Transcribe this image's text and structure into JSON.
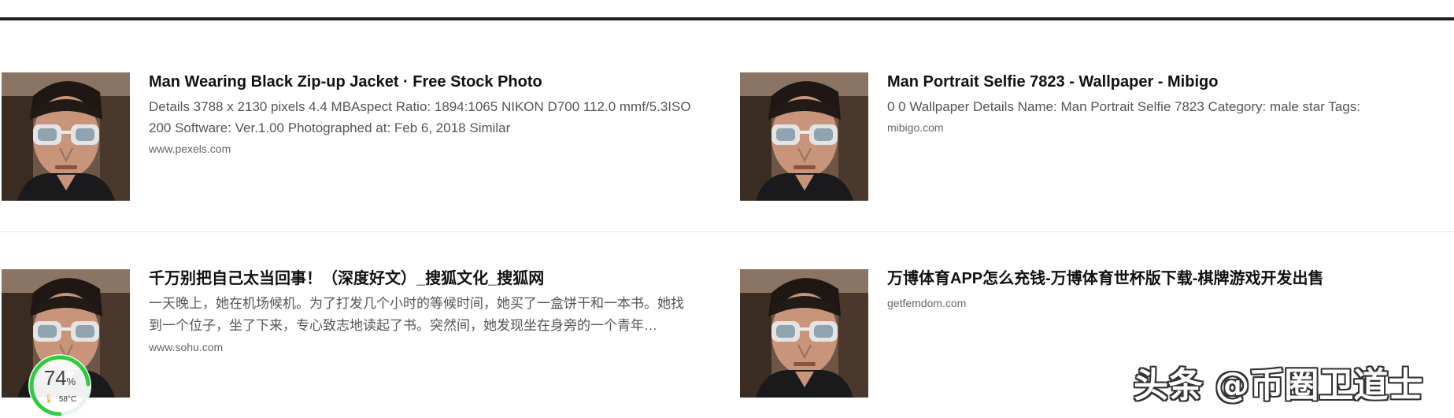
{
  "results": [
    {
      "title": "Man Wearing Black Zip-up Jacket · Free Stock Photo",
      "snippet": "Details 3788 x 2130 pixels 4.4 MBAspect Ratio: 1894:1065 NIKON D700 112.0 mmf/5.3ISO 200 Software: Ver.1.00 Photographed at: Feb 6, 2018 Similar",
      "url": "www.pexels.com",
      "thumbnail_icon": "man-sunglasses-photo"
    },
    {
      "title": "Man Portrait Selfie 7823 - Wallpaper - Mibigo",
      "snippet": "0 0 Wallpaper Details Name: Man Portrait Selfie 7823 Category: male star Tags:",
      "url": "mibigo.com",
      "thumbnail_icon": "man-sunglasses-photo"
    },
    {
      "title": "千万别把自己太当回事！（深度好文）_搜狐文化_搜狐网",
      "snippet": "一天晚上，她在机场候机。为了打发几个小时的等候时间，她买了一盒饼干和一本书。她找到一个位子，坐了下来，专心致志地读起了书。突然间，她发现坐在身旁的一个青年…",
      "url": "www.sohu.com",
      "thumbnail_icon": "man-sunglasses-photo"
    },
    {
      "title": "万博体育APP怎么充钱-万博体育世杯版下载-棋牌游戏开发出售",
      "snippet": "",
      "url": "getfemdom.com",
      "thumbnail_icon": "man-sunglasses-photo"
    }
  ],
  "system_monitor": {
    "cpu_percent": "74",
    "percent_sign": "%",
    "cpu_fraction": 0.74,
    "temperature": "58°C",
    "ring_color": "#2ecc40"
  },
  "watermark": {
    "text": "头条 @币圈卫道士"
  },
  "colors": {
    "top_rule": "#1f1f1f",
    "title": "#111111",
    "snippet": "#555555",
    "url": "#666666"
  }
}
